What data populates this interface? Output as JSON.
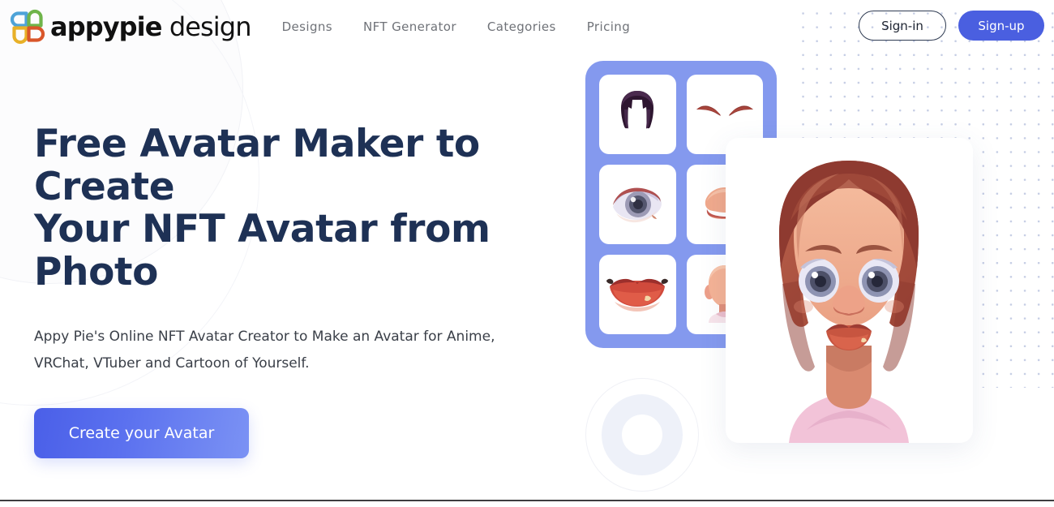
{
  "brand": {
    "name_bold": "appypie",
    "name_light": "design",
    "logo_icon": "appypie-pinwheel-logo",
    "logo_colors": [
      "#4ea3d8",
      "#6fb44a",
      "#e8b128",
      "#d9562a"
    ]
  },
  "nav": {
    "items": [
      {
        "label": "Designs",
        "name": "designs"
      },
      {
        "label": "NFT Generator",
        "name": "nft-generator"
      },
      {
        "label": "Categories",
        "name": "categories"
      },
      {
        "label": "Pricing",
        "name": "pricing"
      }
    ]
  },
  "auth": {
    "signin_label": "Sign-in",
    "signup_label": "Sign-up",
    "signup_color": "#4a5fe0"
  },
  "hero": {
    "title_line1": "Free Avatar Maker to Create",
    "title_line2": "Your NFT Avatar from Photo",
    "title_color": "#1e3155",
    "subtitle_line1": "Appy Pie's Online NFT Avatar Creator to Make an Avatar for Anime,",
    "subtitle_line2": "VRChat, VTuber and Cartoon of Yourself.",
    "cta_label": "Create your Avatar",
    "cta_gradient_from": "#4a5fe8",
    "cta_gradient_to": "#7b92f4"
  },
  "parts_picker": {
    "card_color": "#8499ee",
    "tiles": [
      {
        "name": "hair-tile",
        "label": "Hair"
      },
      {
        "name": "eyebrows-tile",
        "label": "Eyebrows"
      },
      {
        "name": "eye-tile",
        "label": "Eye"
      },
      {
        "name": "nose-tile",
        "label": "Nose"
      },
      {
        "name": "mouth-tile",
        "label": "Mouth"
      },
      {
        "name": "head-tile",
        "label": "Head"
      }
    ]
  },
  "avatar_preview": {
    "name": "female-avatar-illustration",
    "hair_color": "#a9503f",
    "skin_color": "#f0ac8c",
    "eye_color": "#7d87a8",
    "shirt_color": "#f2c3d8"
  },
  "decor": {
    "dot_color": "#c5cde4",
    "ring_color": "#eef1f9"
  }
}
